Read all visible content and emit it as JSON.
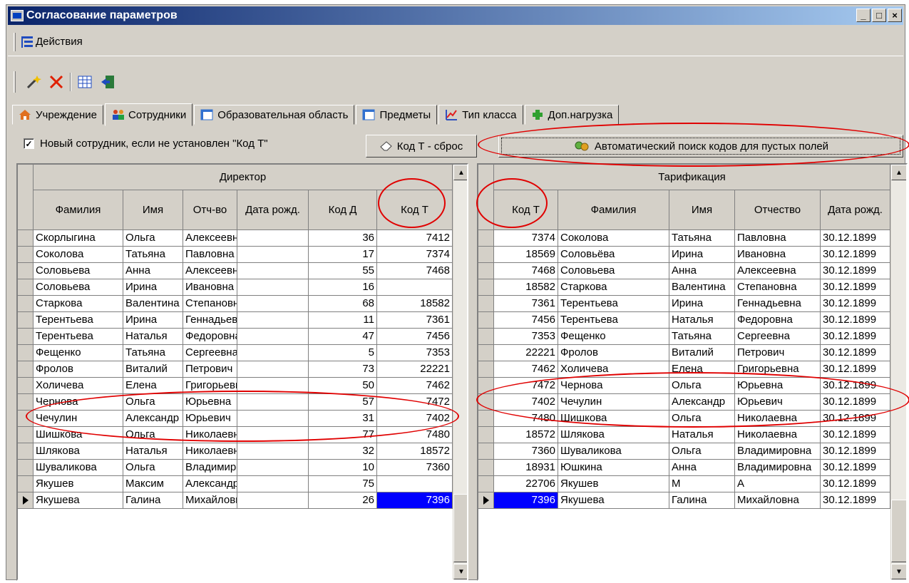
{
  "window": {
    "title": "Согласование параметров",
    "minimize": "_",
    "maximize": "□",
    "close": "×"
  },
  "menu": {
    "actions_label": "Действия"
  },
  "toolbar": {
    "icons": [
      "wand-icon",
      "delete-icon",
      "table-icon",
      "exit-icon"
    ]
  },
  "tabs": [
    {
      "label": "Учреждение",
      "icon": "house-icon"
    },
    {
      "label": "Сотрудники",
      "icon": "people-icon",
      "active": true
    },
    {
      "label": "Образовательная область",
      "icon": "grid-icon"
    },
    {
      "label": "Предметы",
      "icon": "grid-icon"
    },
    {
      "label": "Тип класса",
      "icon": "chart-icon"
    },
    {
      "label": "Доп.нагрузка",
      "icon": "plus-icon"
    }
  ],
  "options": {
    "new_employee_checkbox": "Новый сотрудник, если не установлен \"Код Т\"",
    "checked": true,
    "reset_button": "Код Т - сброс",
    "auto_search_button": "Автоматический поиск кодов для пустых полей"
  },
  "left_grid": {
    "group_header": "Директор",
    "columns": [
      "Фамилия",
      "Имя",
      "Отч-во",
      "Дата рожд.",
      "Код Д",
      "Код Т"
    ],
    "rows": [
      [
        "Скорлыгина",
        "Ольга",
        "Алексеевна",
        "",
        "36",
        "7412"
      ],
      [
        "Соколова",
        "Татьяна",
        "Павловна",
        "",
        "17",
        "7374"
      ],
      [
        "Соловьева",
        "Анна",
        "Алексеевна",
        "",
        "55",
        "7468"
      ],
      [
        "Соловьева",
        "Ирина",
        "Ивановна",
        "",
        "16",
        ""
      ],
      [
        "Старкова",
        "Валентина",
        "Степановна",
        "",
        "68",
        "18582"
      ],
      [
        "Терентьева",
        "Ирина",
        "Геннадьевна",
        "",
        "11",
        "7361"
      ],
      [
        "Терентьева",
        "Наталья",
        "Федоровна",
        "",
        "47",
        "7456"
      ],
      [
        "Фещенко",
        "Татьяна",
        "Сергеевна",
        "",
        "5",
        "7353"
      ],
      [
        "Фролов",
        "Виталий",
        "Петрович",
        "",
        "73",
        "22221"
      ],
      [
        "Холичева",
        "Елена",
        "Григорьевна",
        "",
        "50",
        "7462"
      ],
      [
        "Чернова",
        "Ольга",
        "Юрьевна",
        "",
        "57",
        "7472"
      ],
      [
        "Чечулин",
        "Александр",
        "Юрьевич",
        "",
        "31",
        "7402"
      ],
      [
        "Шишкова",
        "Ольга",
        "Николаевна",
        "",
        "77",
        "7480"
      ],
      [
        "Шлякова",
        "Наталья",
        "Николаевна",
        "",
        "32",
        "18572"
      ],
      [
        "Шуваликова",
        "Ольга",
        "Владимировна",
        "",
        "10",
        "7360"
      ],
      [
        "Якушев",
        "Максим",
        "Александрович",
        "",
        "75",
        ""
      ],
      [
        "Якушева",
        "Галина",
        "Михайловна",
        "",
        "26",
        "7396"
      ]
    ]
  },
  "right_grid": {
    "group_header": "Тарификация",
    "columns": [
      "Код Т",
      "Фамилия",
      "Имя",
      "Отчество",
      "Дата рожд."
    ],
    "rows": [
      [
        "7374",
        "Соколова",
        "Татьяна",
        "Павловна",
        "30.12.1899"
      ],
      [
        "18569",
        "Соловьёва",
        "Ирина",
        "Ивановна",
        "30.12.1899"
      ],
      [
        "7468",
        "Соловьева",
        "Анна",
        "Алексеевна",
        "30.12.1899"
      ],
      [
        "18582",
        "Старкова",
        "Валентина",
        "Степановна",
        "30.12.1899"
      ],
      [
        "7361",
        "Терентьева",
        "Ирина",
        "Геннадьевна",
        "30.12.1899"
      ],
      [
        "7456",
        "Терентьева",
        "Наталья",
        "Федоровна",
        "30.12.1899"
      ],
      [
        "7353",
        "Фещенко",
        "Татьяна",
        "Сергеевна",
        "30.12.1899"
      ],
      [
        "22221",
        "Фролов",
        "Виталий",
        "Петрович",
        "30.12.1899"
      ],
      [
        "7462",
        "Холичева",
        "Елена",
        "Григорьевна",
        "30.12.1899"
      ],
      [
        "7472",
        "Чернова",
        "Ольга",
        "Юрьевна",
        "30.12.1899"
      ],
      [
        "7402",
        "Чечулин",
        "Александр",
        "Юрьевич",
        "30.12.1899"
      ],
      [
        "7480",
        "Шишкова",
        "Ольга",
        "Николаевна",
        "30.12.1899"
      ],
      [
        "18572",
        "Шлякова",
        "Наталья",
        "Николаевна",
        "30.12.1899"
      ],
      [
        "7360",
        "Шуваликова",
        "Ольга",
        "Владимировна",
        "30.12.1899"
      ],
      [
        "18931",
        "Юшкина",
        "Анна",
        "Владимировна",
        "30.12.1899"
      ],
      [
        "22706",
        "Якушев",
        "М",
        "А",
        "30.12.1899"
      ],
      [
        "7396",
        "Якушева",
        "Галина",
        "Михайловна",
        "30.12.1899"
      ]
    ]
  },
  "colors": {
    "selection": "#0000ff",
    "annotation": "#e00000",
    "title_start": "#0a246a",
    "title_end": "#a6caf0"
  }
}
